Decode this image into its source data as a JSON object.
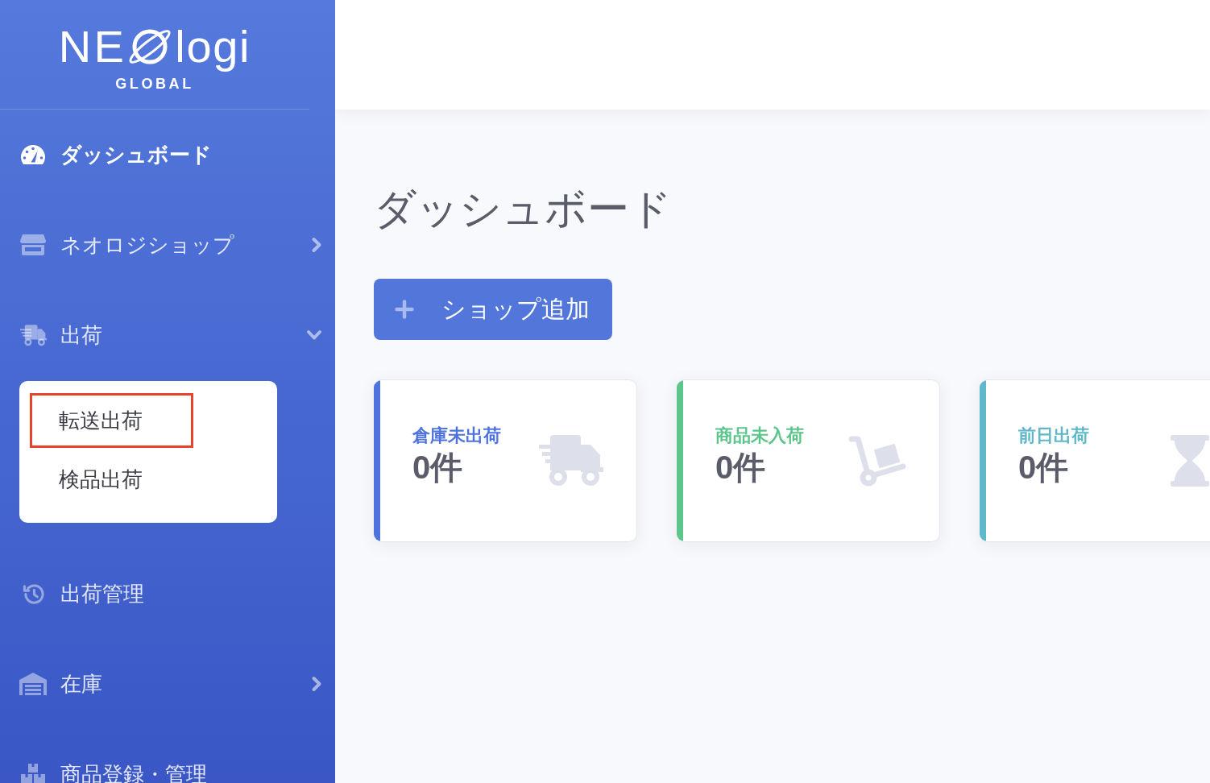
{
  "sidebar": {
    "logo": {
      "text_before": "NE",
      "text_after": "logi",
      "subtitle": "GLOBAL"
    },
    "items": [
      {
        "kind": "link",
        "label": "ダッシュボード",
        "selected": true
      },
      {
        "kind": "group",
        "label": "ネオロジショップ",
        "selected": false,
        "expanded": false
      },
      {
        "kind": "group",
        "label": "出荷",
        "selected": false,
        "expanded": true,
        "children": [
          {
            "label": "転送出荷",
            "highlighted": true
          },
          {
            "label": "検品出荷",
            "highlighted": false
          }
        ]
      },
      {
        "kind": "link",
        "label": "出荷管理",
        "selected": false
      },
      {
        "kind": "group",
        "label": "在庫",
        "selected": false,
        "expanded": false
      },
      {
        "kind": "link",
        "label": "商品登録・管理",
        "selected": false
      }
    ]
  },
  "page": {
    "title": "ダッシュボード",
    "add_button": {
      "label": "ショップ追加"
    }
  },
  "stat_cards": [
    {
      "label": "倉庫未出荷",
      "value": "0件",
      "color": "#4e73df"
    },
    {
      "label": "商品未入荷",
      "value": "0件",
      "color": "#5cc58b"
    },
    {
      "label": "前日出荷",
      "value": "0件",
      "color": "#5fb8c9"
    }
  ]
}
